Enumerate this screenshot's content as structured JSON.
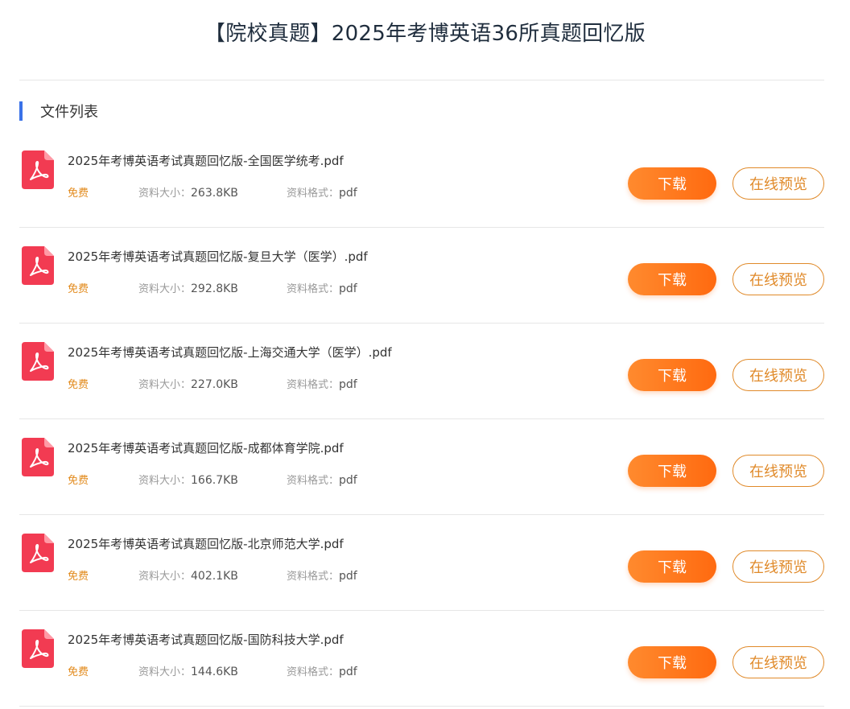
{
  "page": {
    "title": "【院校真题】2025年考博英语36所真题回忆版"
  },
  "section": {
    "title": "文件列表"
  },
  "labels": {
    "free": "免费",
    "size_label": "资料大小：",
    "format_label": "资料格式：",
    "download": "下载",
    "preview": "在线预览"
  },
  "colors": {
    "accent_blue": "#3a72e8",
    "download_orange": "#ff7a1e",
    "preview_orange": "#e08a2a",
    "pdf_red": "#f23b52"
  },
  "files": [
    {
      "name": "2025年考博英语考试真题回忆版-全国医学统考.pdf",
      "size": "263.8KB",
      "format": "pdf"
    },
    {
      "name": "2025年考博英语考试真题回忆版-复旦大学（医学）.pdf",
      "size": "292.8KB",
      "format": "pdf"
    },
    {
      "name": "2025年考博英语考试真题回忆版-上海交通大学（医学）.pdf",
      "size": "227.0KB",
      "format": "pdf"
    },
    {
      "name": "2025年考博英语考试真题回忆版-成都体育学院.pdf",
      "size": "166.7KB",
      "format": "pdf"
    },
    {
      "name": "2025年考博英语考试真题回忆版-北京师范大学.pdf",
      "size": "402.1KB",
      "format": "pdf"
    },
    {
      "name": "2025年考博英语考试真题回忆版-国防科技大学.pdf",
      "size": "144.6KB",
      "format": "pdf"
    }
  ]
}
